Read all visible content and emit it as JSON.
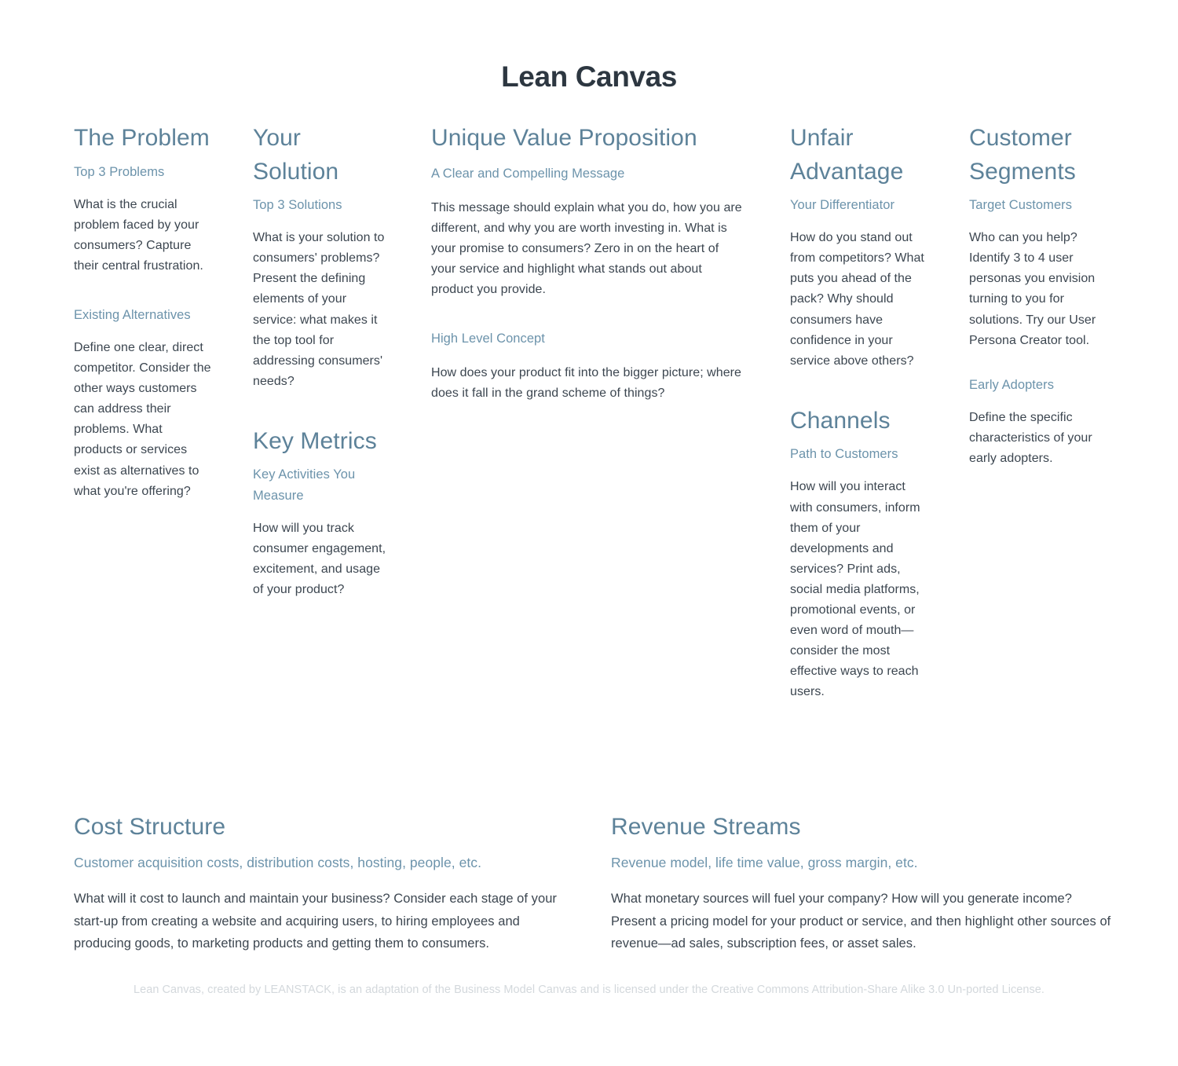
{
  "document": {
    "title": "Lean Canvas",
    "footer_note": "Lean Canvas, created by LEANSTACK, is an adaptation of the Business Model Canvas and is licensed under the Creative Commons Attribution-Share Alike 3.0 Un-ported License.",
    "colors": {
      "heading": "#5d8299",
      "subheading": "#6c93ab",
      "body": "#3c4650",
      "title": "#2d3741",
      "footer": "#d3d8dc",
      "background": "#ffffff"
    }
  },
  "blocks": {
    "problem": {
      "title": "The Problem",
      "sub": "Top 3 Problems",
      "body": "What is the crucial problem faced by your consumers? Capture their central frustration.",
      "sub2": "Existing Alternatives",
      "body2": "Define one clear, direct competitor. Consider the other ways customers can address their problems. What products or services exist as alternatives to what you're offering?"
    },
    "solution": {
      "title": "Your Solution",
      "sub": "Top 3 Solutions",
      "body": "What is your solution to consumers' problems? Present the defining elements of your service: what makes it the top tool for addressing consumers' needs?"
    },
    "key_metrics": {
      "title": "Key Metrics",
      "sub": "Key Activities You Measure",
      "body": "How will you track consumer engagement, excitement, and usage of your product?"
    },
    "uvp": {
      "title": "Unique Value Proposition",
      "sub": "A Clear and Compelling Message",
      "body": "This message should explain what you do, how you are different, and why you are worth investing in. What is your promise to consumers? Zero in on the heart of your service and highlight what stands out about product you provide.",
      "sub2": "High Level Concept",
      "body2": "How does your product fit into the bigger picture; where does it fall in the grand scheme of things?"
    },
    "unfair_advantage": {
      "title": "Unfair Advantage",
      "sub": "Your Differentiator",
      "body": "How do you stand out from competitors? What puts you ahead of the pack? Why should consumers have confidence in your service above others?"
    },
    "channels": {
      "title": "Channels",
      "sub": "Path to Customers",
      "body": "How will you interact with consumers, inform them of your developments and services? Print ads, social media platforms, promotional events, or even word of mouth—consider the most effective ways to reach users."
    },
    "customer_segments": {
      "title": "Customer Segments",
      "sub": "Target Customers",
      "body": "Who can you help? Identify 3 to 4 user personas you envision turning to you for solutions. Try our User Persona Creator tool.",
      "sub2": "Early Adopters",
      "body2": "Define the specific characteristics of your early adopters."
    },
    "cost_structure": {
      "title": "Cost Structure",
      "sub": "Customer acquisition costs, distribution costs, hosting, people, etc.",
      "body": "What will it cost to launch and maintain your business? Consider each stage of your start-up from creating a website and acquiring users, to hiring employees and producing goods, to marketing products and getting them to consumers."
    },
    "revenue_streams": {
      "title": "Revenue Streams",
      "sub": "Revenue model, life time value, gross margin, etc.",
      "body": "What monetary sources will fuel your company? How will you generate income? Present a pricing model for your product or service, and then highlight other sources of revenue—ad sales, subscription fees, or asset sales."
    }
  }
}
